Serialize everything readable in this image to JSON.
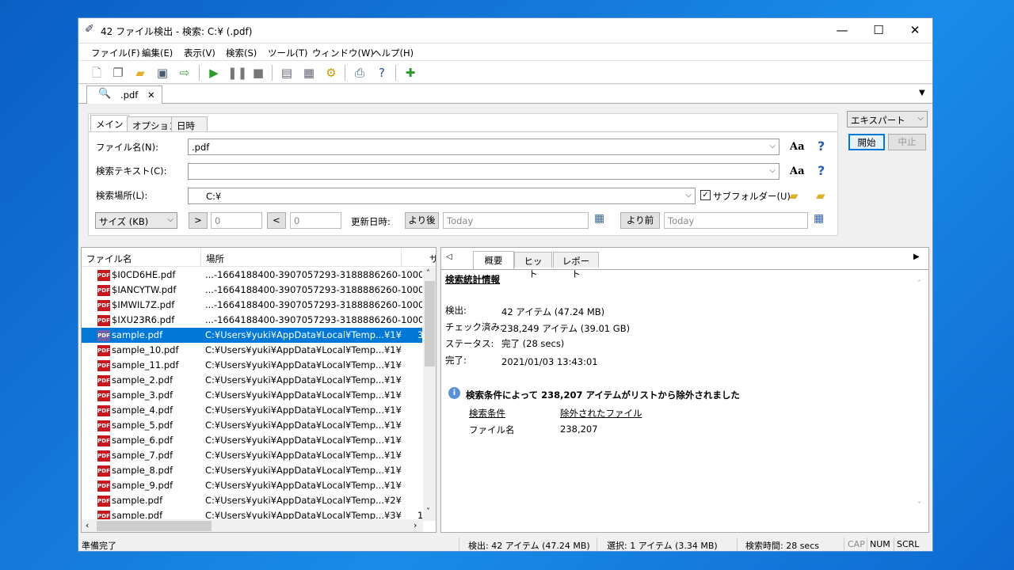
{
  "window": {
    "title": "42 ファイル検出 - 検索: C:¥ (.pdf)",
    "minimize": "—",
    "maximize": "☐",
    "close": "✕"
  },
  "menu": [
    "ファイル(F)",
    "編集(E)",
    "表示(V)",
    "検索(S)",
    "ツール(T)",
    "ウィンドウ(W)",
    "ヘルプ(H)"
  ],
  "toolbar_icons": [
    "new-icon",
    "copy-icon",
    "open-folder-icon",
    "save-icon",
    "export-icon",
    "play-icon",
    "pause-icon",
    "stop-icon",
    "view1-icon",
    "view2-icon",
    "settings-doc-icon",
    "print-icon",
    "help-book-icon",
    "tools-add-icon"
  ],
  "doc_tab": {
    "label": ".pdf",
    "close": "✕",
    "menu_arrow": "▼"
  },
  "search": {
    "tabs": [
      "メイン",
      "オプション",
      "日時"
    ],
    "filename_label": "ファイル名(N):",
    "filename_value": ".pdf",
    "text_label": "検索テキスト(C):",
    "text_value": "",
    "location_label": "検索場所(L):",
    "location_value": "C:¥",
    "subfolder_label": "サブフォルダー(U)",
    "subfolder_checked": true,
    "size_select": "サイズ (KB)",
    "gt": ">",
    "gt_value": "0",
    "lt": "<",
    "lt_value": "0",
    "date_label": "更新日時:",
    "after": "より後",
    "after_value": "Today",
    "before": "より前",
    "before_value": "Today",
    "case_icon": "Aa",
    "help_icon": "?",
    "mode": "エキスパート",
    "start": "開始",
    "stop": "中止"
  },
  "list": {
    "columns": [
      "ファイル名",
      "場所",
      "サ"
    ],
    "rows": [
      {
        "name": "$I0CD6HE.pdf",
        "location": "...-1664188400-3907057293-3188886260-1000",
        "size": ""
      },
      {
        "name": "$IANCYTW.pdf",
        "location": "...-1664188400-3907057293-3188886260-1000",
        "size": ""
      },
      {
        "name": "$IMWIL7Z.pdf",
        "location": "...-1664188400-3907057293-3188886260-1000",
        "size": ""
      },
      {
        "name": "$IXU23R6.pdf",
        "location": "...-1664188400-3907057293-3188886260-1000",
        "size": ""
      },
      {
        "name": "sample.pdf",
        "location": "C:¥Users¥yuki¥AppData¥Local¥Temp...¥1¥",
        "size": "3",
        "selected": true
      },
      {
        "name": "sample_10.pdf",
        "location": "C:¥Users¥yuki¥AppData¥Local¥Temp...¥1¥",
        "size": ""
      },
      {
        "name": "sample_11.pdf",
        "location": "C:¥Users¥yuki¥AppData¥Local¥Temp...¥1¥",
        "size": ""
      },
      {
        "name": "sample_2.pdf",
        "location": "C:¥Users¥yuki¥AppData¥Local¥Temp...¥1¥",
        "size": ""
      },
      {
        "name": "sample_3.pdf",
        "location": "C:¥Users¥yuki¥AppData¥Local¥Temp...¥1¥",
        "size": ""
      },
      {
        "name": "sample_4.pdf",
        "location": "C:¥Users¥yuki¥AppData¥Local¥Temp...¥1¥",
        "size": ""
      },
      {
        "name": "sample_5.pdf",
        "location": "C:¥Users¥yuki¥AppData¥Local¥Temp...¥1¥",
        "size": ""
      },
      {
        "name": "sample_6.pdf",
        "location": "C:¥Users¥yuki¥AppData¥Local¥Temp...¥1¥",
        "size": ""
      },
      {
        "name": "sample_7.pdf",
        "location": "C:¥Users¥yuki¥AppData¥Local¥Temp...¥1¥",
        "size": ""
      },
      {
        "name": "sample_8.pdf",
        "location": "C:¥Users¥yuki¥AppData¥Local¥Temp...¥1¥",
        "size": ""
      },
      {
        "name": "sample_9.pdf",
        "location": "C:¥Users¥yuki¥AppData¥Local¥Temp...¥1¥",
        "size": ""
      },
      {
        "name": "sample.pdf",
        "location": "C:¥Users¥yuki¥AppData¥Local¥Temp...¥2¥",
        "size": ""
      },
      {
        "name": "sample.pdf",
        "location": "C:¥Users¥yuki¥AppData¥Local¥Temp...¥3¥",
        "size": "1"
      }
    ]
  },
  "summary": {
    "tabs": [
      "概要",
      "ヒット",
      "レポート"
    ],
    "heading": "検索統計情報",
    "stats": [
      {
        "label": "検出:",
        "value": "42 アイテム (47.24 MB)"
      },
      {
        "label": "チェック済み:",
        "value": "238,249 アイテム (39.01 GB)"
      },
      {
        "label": "ステータス:",
        "value": "完了 (28 secs)"
      },
      {
        "label": "完了:",
        "value": "2021/01/03 13:43:01"
      }
    ],
    "excluded_message": "検索条件によって 238,207 アイテムがリストから除外されました",
    "excluded_headers": [
      "検索条件",
      "除外されたファイル"
    ],
    "excluded_rows": [
      {
        "criterion": "ファイル名",
        "count": "238,207"
      }
    ]
  },
  "status": {
    "ready": "準備完了",
    "found": "検出: 42 アイテム (47.24 MB)",
    "selected": "選択: 1 アイテム (3.34 MB)",
    "time": "検索時間: 28 secs",
    "cap": "CAP",
    "num": "NUM",
    "scrl": "SCRL"
  }
}
